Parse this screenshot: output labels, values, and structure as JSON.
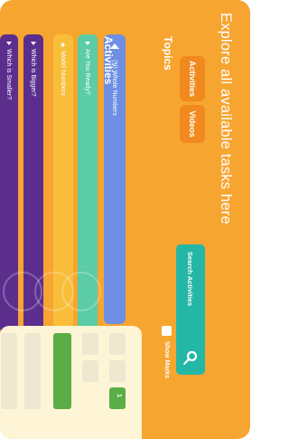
{
  "header": {
    "title": "Explore all available tasks here"
  },
  "tabs": [
    {
      "label": "Activities"
    },
    {
      "label": "Videos"
    }
  ],
  "sections": {
    "topics": "Topics",
    "activities": "Activities"
  },
  "search": {
    "label": "Search Activities"
  },
  "toggles": {
    "show_marks": "Show Marks"
  },
  "topic_row": {
    "label": "(N) Whole Numbers"
  },
  "activities": [
    {
      "label": "Are You Ready?"
    },
    {
      "label": "Model Numbers"
    },
    {
      "label": "Which is Bigger?"
    },
    {
      "label": "Which is Smaller?"
    }
  ],
  "marks": {
    "chip": "1"
  },
  "colors": {
    "panel": "#F7A531",
    "search": "#25B7A6",
    "blue": "#6E8FE3",
    "green": "#5BCCA5",
    "yellow": "#F8BE3A",
    "purple": "#5B2E8E"
  }
}
